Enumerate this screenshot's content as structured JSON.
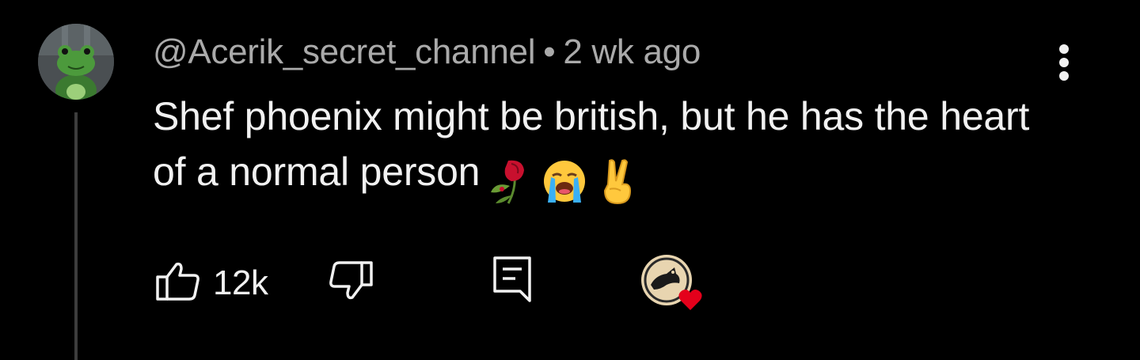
{
  "comment": {
    "author": "@Acerik_secret_channel",
    "separator": "•",
    "time": "2 wk ago",
    "text": "Shef phoenix might be british, but he has the heart of a normal person",
    "emojis": [
      "wilted-rose",
      "loudly-crying-face",
      "victory-hand"
    ],
    "like_count": "12k"
  },
  "colors": {
    "background": "#000000",
    "primary_text": "#f1f1f1",
    "secondary_text": "#aaaaaa",
    "heart": "#e4001b"
  }
}
